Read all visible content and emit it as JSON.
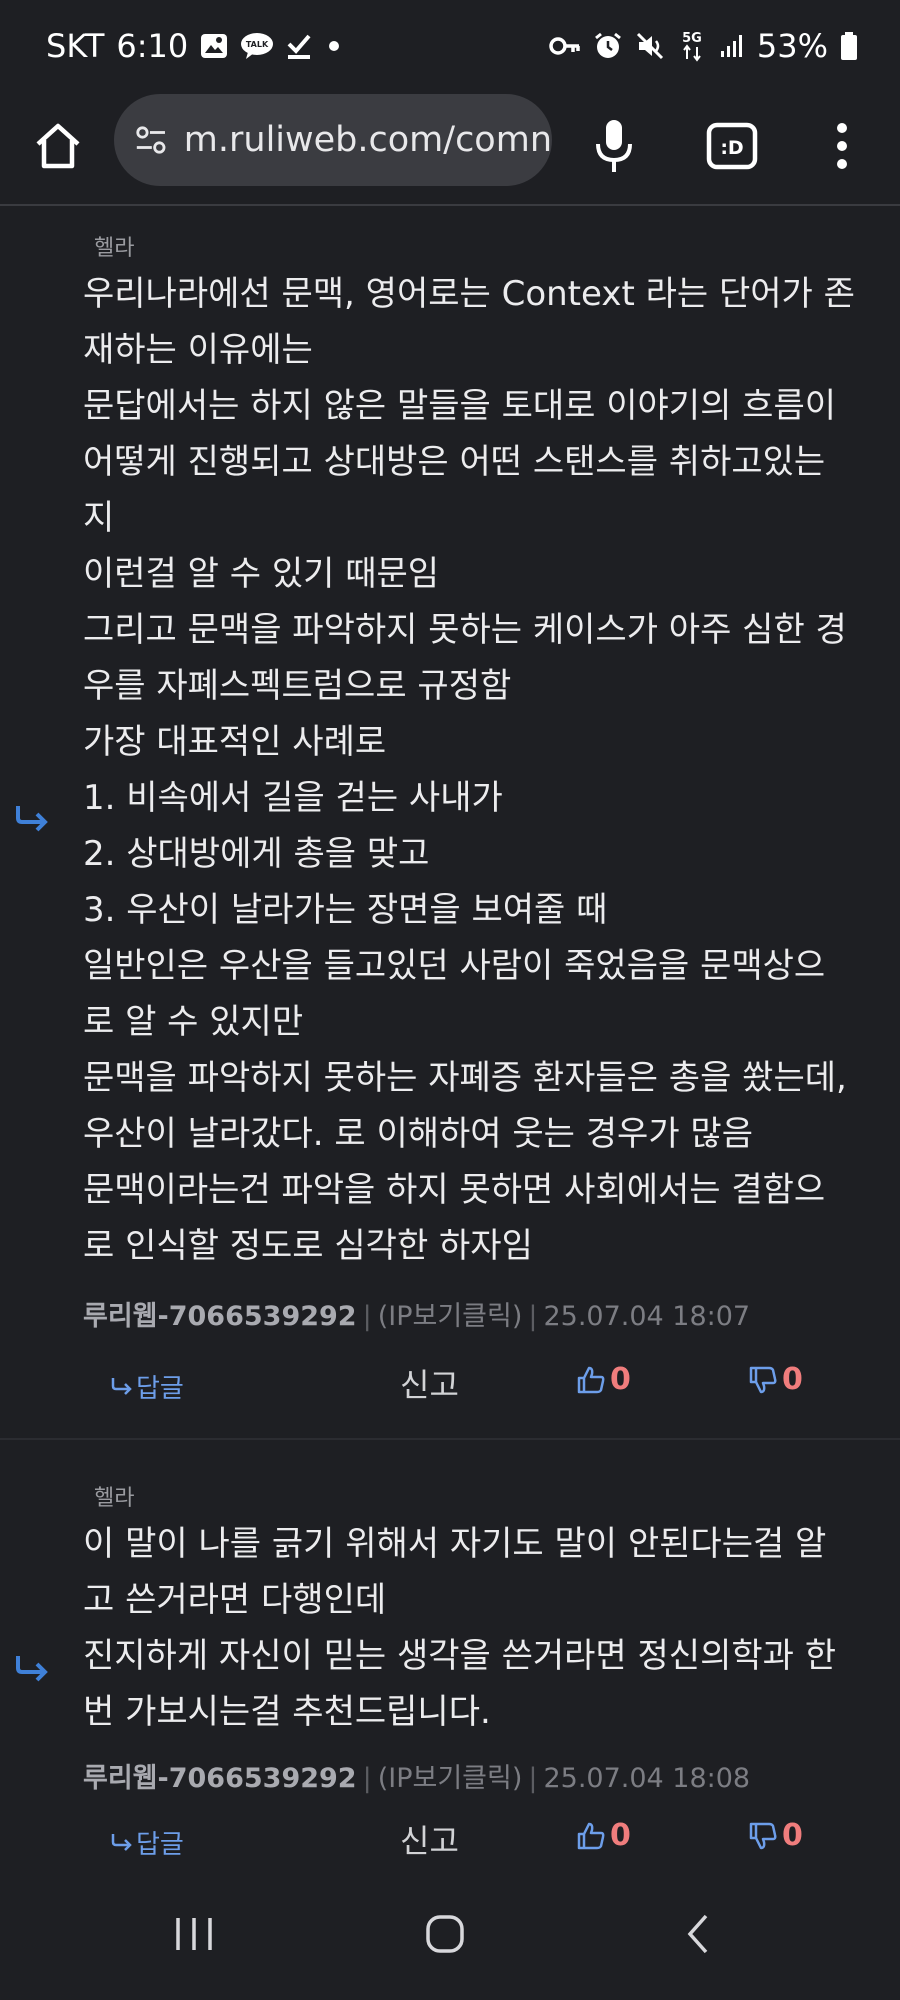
{
  "status_bar": {
    "carrier": "SKT",
    "time": "6:10",
    "talk_badge": "TALK",
    "network": "5G",
    "battery": "53%"
  },
  "toolbar": {
    "url": "m.ruliweb.com/comn",
    "tabs_label": ":D"
  },
  "comments": [
    {
      "target_user": "헬라",
      "lines": [
        "우리나라에선 문맥, 영어로는 Context 라는 단어가 존",
        "재하는 이유에는",
        "문답에서는 하지 않은 말들을 토대로 이야기의 흐름이",
        "어떻게 진행되고 상대방은 어떤 스탠스를 취하고있는",
        "지",
        "이런걸 알 수 있기 때문임",
        "그리고 문맥을 파악하지 못하는 케이스가 아주 심한 경",
        "우를 자폐스펙트럼으로 규정함",
        "가장 대표적인 사례로",
        "1. 비속에서 길을 걷는 사내가",
        "2. 상대방에게 총을 맞고",
        "3. 우산이 날라가는 장면을 보여줄 때",
        "일반인은 우산을 들고있던 사람이 죽었음을 문맥상으",
        "로 알 수 있지만",
        "문맥을 파악하지 못하는 자폐증 환자들은 총을 쐈는데,",
        "우산이 날라갔다. 로 이해하여 웃는 경우가 많음",
        "문맥이라는건 파악을 하지 못하면 사회에서는 결함으",
        "로 인식할 정도로 심각한 하자임"
      ],
      "author": "루리웹-7066539292",
      "ip": "(IP보기클릭)",
      "date": "25.07.04 18:07",
      "reply_label": "답글",
      "report_label": "신고",
      "likes": "0",
      "dislikes": "0"
    },
    {
      "target_user": "헬라",
      "lines": [
        "이 말이 나를 긁기 위해서 자기도 말이 안된다는걸 알",
        "고 쓴거라면 다행인데",
        "진지하게 자신이 믿는 생각을 쓴거라면 정신의학과 한",
        "번 가보시는걸 추천드립니다."
      ],
      "author": "루리웹-7066539292",
      "ip": "(IP보기클릭)",
      "date": "25.07.04 18:08",
      "reply_label": "답글",
      "report_label": "신고",
      "likes": "0",
      "dislikes": "0"
    }
  ],
  "icons": {
    "reply_arrow_color": "#3f80d8",
    "accent_blue": "#6d9eea",
    "vote_color": "#f07d7d"
  }
}
